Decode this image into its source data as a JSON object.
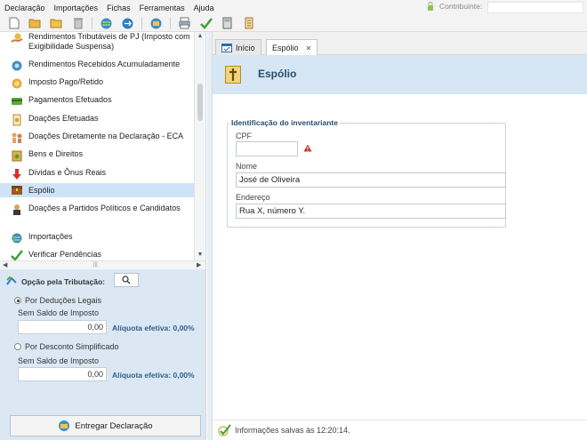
{
  "menu": {
    "items": [
      "Declaração",
      "Importações",
      "Fichas",
      "Ferramentas",
      "Ajuda"
    ],
    "contributor_label": "Contribuinte:"
  },
  "toolbar": {
    "icons": [
      "new-document-icon",
      "open-folder-icon",
      "folder-icon",
      "trash-icon",
      "transmit-globe-icon",
      "globe-arrows-icon",
      "globe-refresh-icon",
      "print-icon",
      "check-icon",
      "calculator-icon",
      "receipt-icon"
    ]
  },
  "sidebar": {
    "items": [
      {
        "label": "Rendimentos Tributáveis de PJ (Imposto com Exigibilidade Suspensa)",
        "icon": "hand-coin-icon"
      },
      {
        "label": "Rendimentos Recebidos Acumuladamente",
        "icon": "coins-icon"
      },
      {
        "label": "Imposto Pago/Retido",
        "icon": "money-icon"
      },
      {
        "label": "Pagamentos Efetuados",
        "icon": "card-icon"
      },
      {
        "label": "Doações Efetuadas",
        "icon": "donation-icon"
      },
      {
        "label": "Doações Diretamente na Declaração - ECA",
        "icon": "children-icon"
      },
      {
        "label": "Bens e Direitos",
        "icon": "house-money-icon"
      },
      {
        "label": "Dívidas e Ônus Reais",
        "icon": "debt-arrow-icon"
      },
      {
        "label": "Espólio",
        "icon": "chest-icon"
      },
      {
        "label": "Doações a Partidos Políticos e Candidatos",
        "icon": "party-icon"
      },
      {
        "label": "Importações",
        "icon": "import-icon"
      },
      {
        "label": "Verificar Pendências",
        "icon": "check-icon"
      }
    ],
    "selected_index": 8
  },
  "tributacao": {
    "title": "Opção pela Tributação:",
    "option1_label": "Por Deduções Legais",
    "option1_sublabel": "Sem Saldo de Imposto",
    "option1_value": "0,00",
    "option1_aliquota": "Alíquota efetiva: 0,00%",
    "option2_label": "Por Desconto Simplificado",
    "option2_sublabel": "Sem Saldo de Imposto",
    "option2_value": "0,00",
    "option2_aliquota": "Alíquota efetiva: 0,00%",
    "selected_option": 1,
    "submit_label": "Entregar Declaração"
  },
  "tabs": [
    {
      "label": "Início",
      "icon": "home-icon"
    },
    {
      "label": "Espólio",
      "closable": true
    }
  ],
  "page": {
    "title": "Espólio",
    "section_title": "Identificação do inventariante",
    "cpf_label": "CPF",
    "cpf_value": "",
    "nome_label": "Nome",
    "nome_value": "José de Oliveira",
    "endereco_label": "Endereço",
    "endereco_value": "Rua X, número Y."
  },
  "status": {
    "text": "Informações salvas às 12:20:14."
  },
  "colors": {
    "accent": "#2a4d6e",
    "header_bg": "#d6e6f4",
    "panel_bg": "#dbe8f4",
    "selection": "#cfe3f7",
    "warning": "#d0332a"
  }
}
